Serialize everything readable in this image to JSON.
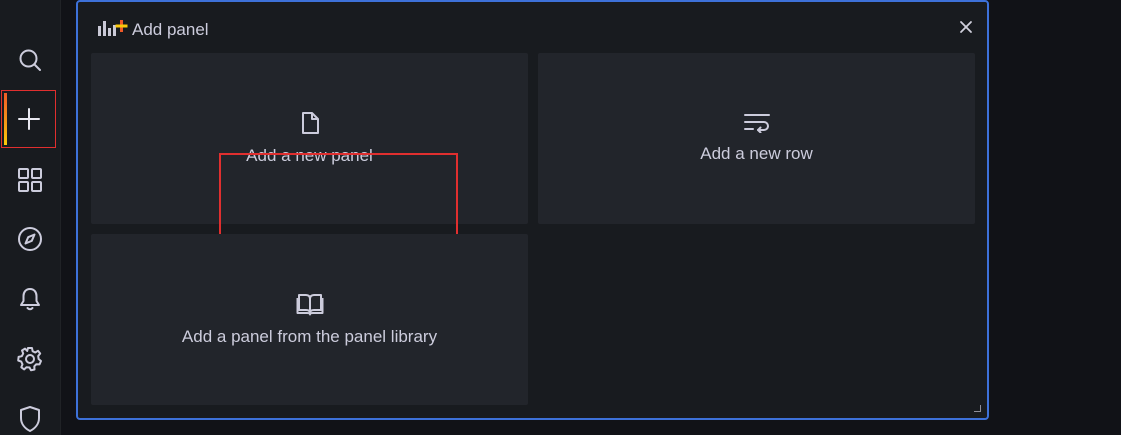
{
  "sidebar": {
    "items": [
      {
        "icon": "search-icon"
      },
      {
        "icon": "plus-icon",
        "active": true
      },
      {
        "icon": "dashboards-icon"
      },
      {
        "icon": "explore-icon"
      },
      {
        "icon": "alerting-bell-icon"
      },
      {
        "icon": "gear-icon"
      },
      {
        "icon": "shield-icon"
      }
    ]
  },
  "panel": {
    "title": "Add panel",
    "title_icon": "add-panel-icon",
    "close_icon": "close-icon",
    "options": [
      {
        "label": "Add a new panel",
        "icon": "file-icon",
        "highlighted": true
      },
      {
        "label": "Add a new row",
        "icon": "row-icon"
      },
      {
        "label": "Add a panel from the panel library",
        "icon": "book-icon"
      }
    ]
  },
  "colors": {
    "background": "#111217",
    "panel_bg": "#181b1f",
    "card_bg": "#22252b",
    "panel_border": "#3d71d9",
    "highlight_border": "#e02f2f",
    "text": "#ccccdc",
    "accent_orange": "#f05a28"
  }
}
